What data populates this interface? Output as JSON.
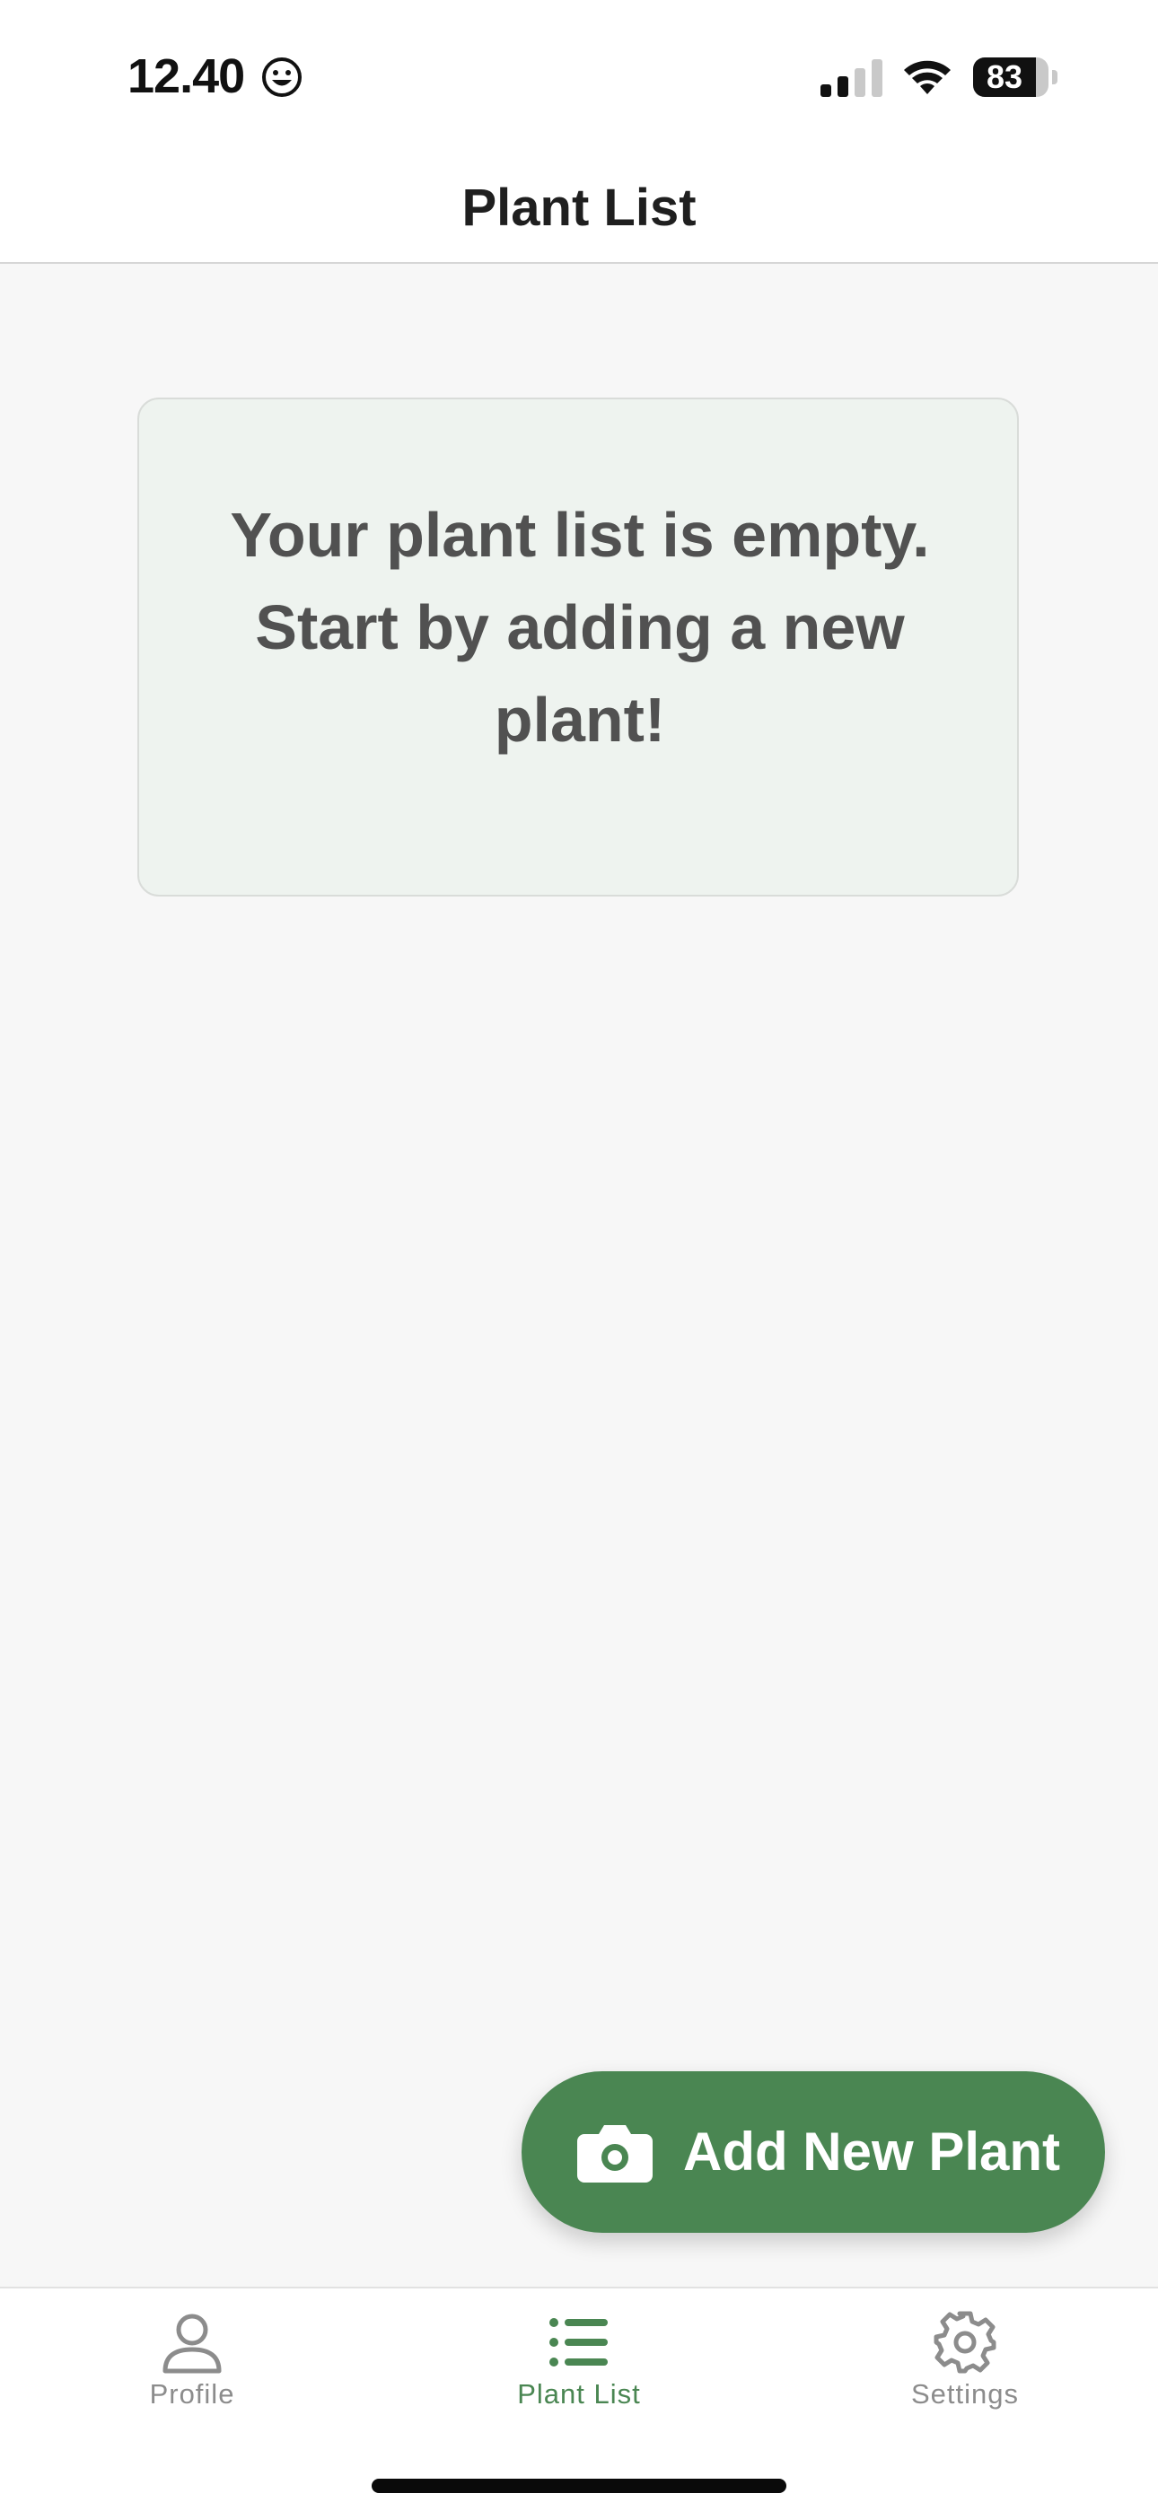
{
  "status_bar": {
    "time": "12.40",
    "battery_level": "83",
    "battery_fraction": 0.83,
    "icons": [
      "smiley-icon",
      "signal-icon",
      "wifi-icon",
      "battery-icon"
    ]
  },
  "header": {
    "title": "Plant List"
  },
  "empty_state": {
    "message": "Your plant list is empty. Start by adding a new plant!"
  },
  "fab": {
    "label": "Add New Plant",
    "icon": "camera-icon"
  },
  "tabs": [
    {
      "label": "Profile",
      "icon": "person-icon",
      "active": false
    },
    {
      "label": "Plant List",
      "icon": "list-icon",
      "active": true
    },
    {
      "label": "Settings",
      "icon": "gear-icon",
      "active": false
    }
  ],
  "colors": {
    "accent": "#4a8652",
    "card_background": "#eef3ef",
    "page_background": "#f7f7f7",
    "inactive_tab": "#8c8c8c"
  }
}
